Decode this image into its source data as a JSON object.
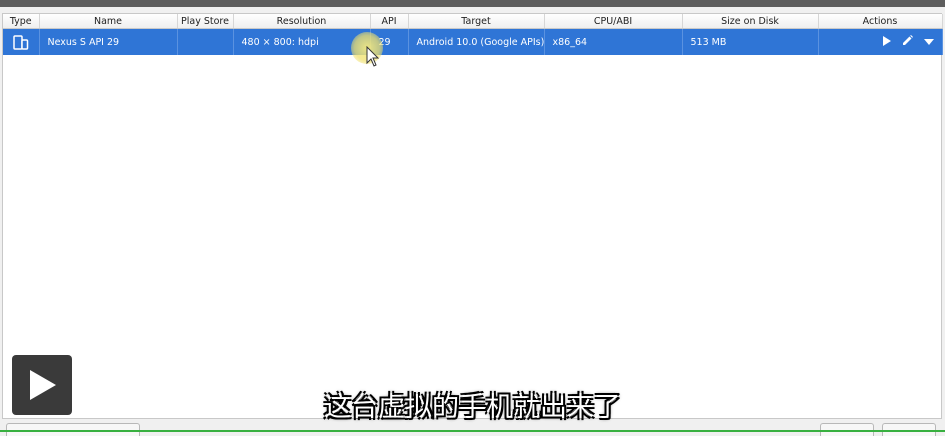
{
  "table": {
    "columns": [
      "Type",
      "Name",
      "Play Store",
      "Resolution",
      "API",
      "Target",
      "CPU/ABI",
      "Size on Disk",
      "Actions"
    ],
    "rows": [
      {
        "type_icon": "device-icon",
        "name": "Nexus S API 29",
        "play_store": "",
        "resolution": "480 × 800: hdpi",
        "api": "29",
        "target": "Android 10.0 (Google APIs)",
        "cpu_abi": "x86_64",
        "size_on_disk": "513 MB",
        "actions": [
          "launch-icon",
          "edit-icon",
          "menu-dropdown-icon"
        ]
      }
    ]
  },
  "video": {
    "play_icon": "play-icon",
    "subtitle": "这台虚拟的手机就出来了"
  },
  "colors": {
    "selection": "#2f75d6",
    "selection_text": "#ffffff",
    "progress": "#38b040"
  }
}
